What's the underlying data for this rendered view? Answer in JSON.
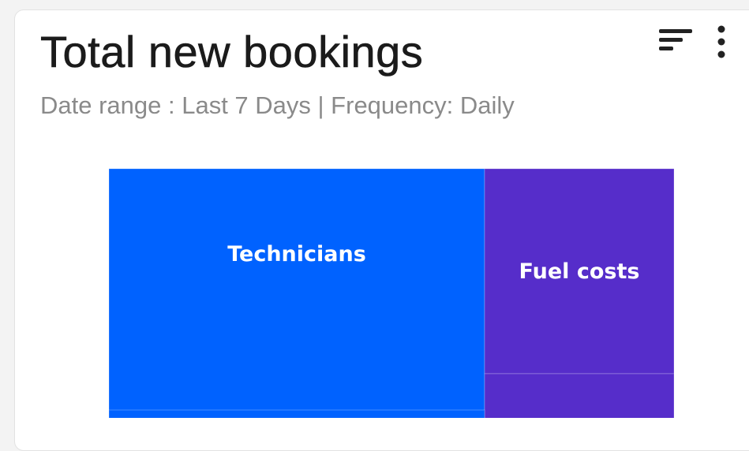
{
  "widget": {
    "title": "Total new bookings",
    "subtitle": "Date range : Last 7 Days | Frequency: Daily",
    "icons": {
      "sort": "sort-lines-icon",
      "more": "more-vertical-icon"
    }
  },
  "chart_data": {
    "type": "treemap",
    "series": [
      {
        "name": "Technicians",
        "color": "#0062ff"
      },
      {
        "name": "Fuel costs",
        "color": "#562dca"
      },
      {
        "name": "",
        "color": "#562dca"
      }
    ]
  }
}
